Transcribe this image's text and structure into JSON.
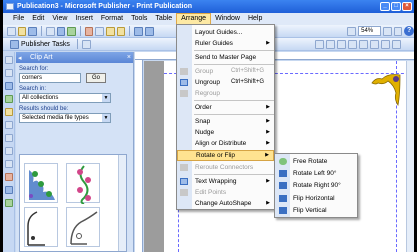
{
  "window": {
    "title": "Publication3 - Microsoft Publisher - Print Publication",
    "min": "_",
    "max": "□",
    "close": "×"
  },
  "menubar": {
    "items": [
      "File",
      "Edit",
      "View",
      "Insert",
      "Format",
      "Tools",
      "Table",
      "Arrange",
      "Window",
      "Help"
    ]
  },
  "toolbar": {
    "zoom": "54%",
    "publisher_tasks": "Publisher Tasks"
  },
  "taskpane": {
    "title": "Clip Art",
    "search_label": "Search for:",
    "search_value": "corners",
    "go_button": "Go",
    "search_in_label": "Search in:",
    "search_in_value": "All collections",
    "results_label": "Results should be:",
    "results_value": "Selected media file types"
  },
  "arrange_menu": {
    "items": [
      {
        "label": "Layout Guides...",
        "shortcut": "",
        "disabled": false,
        "submenu": false
      },
      {
        "label": "Ruler Guides",
        "shortcut": "",
        "disabled": false,
        "submenu": true
      },
      {
        "label": "Send to Master Page",
        "shortcut": "",
        "disabled": false,
        "submenu": false
      },
      {
        "label": "Group",
        "shortcut": "Ctrl+Shift+G",
        "disabled": true,
        "submenu": false
      },
      {
        "label": "Ungroup",
        "shortcut": "Ctrl+Shift+G",
        "disabled": false,
        "submenu": false
      },
      {
        "label": "Regroup",
        "shortcut": "",
        "disabled": true,
        "submenu": false
      },
      {
        "label": "Order",
        "shortcut": "",
        "disabled": false,
        "submenu": true
      },
      {
        "label": "Snap",
        "shortcut": "",
        "disabled": false,
        "submenu": true
      },
      {
        "label": "Nudge",
        "shortcut": "",
        "disabled": false,
        "submenu": true
      },
      {
        "label": "Align or Distribute",
        "shortcut": "",
        "disabled": false,
        "submenu": true
      },
      {
        "label": "Rotate or Flip",
        "shortcut": "",
        "disabled": false,
        "submenu": true,
        "highlighted": true
      },
      {
        "label": "Reroute Connectors",
        "shortcut": "",
        "disabled": true,
        "submenu": false
      },
      {
        "label": "Text Wrapping",
        "shortcut": "",
        "disabled": false,
        "submenu": true
      },
      {
        "label": "Edit Points",
        "shortcut": "",
        "disabled": true,
        "submenu": false
      },
      {
        "label": "Change AutoShape",
        "shortcut": "",
        "disabled": false,
        "submenu": true
      }
    ]
  },
  "rotate_submenu": {
    "items": [
      {
        "label": "Free Rotate"
      },
      {
        "label": "Rotate Left 90°"
      },
      {
        "label": "Rotate Right 90°"
      },
      {
        "label": "Flip Horizontal"
      },
      {
        "label": "Flip Vertical"
      }
    ]
  },
  "colors": {
    "title_bar": "#1f5fd8",
    "highlight": "#ffe391",
    "menu_gutter": "#dde7f6"
  }
}
